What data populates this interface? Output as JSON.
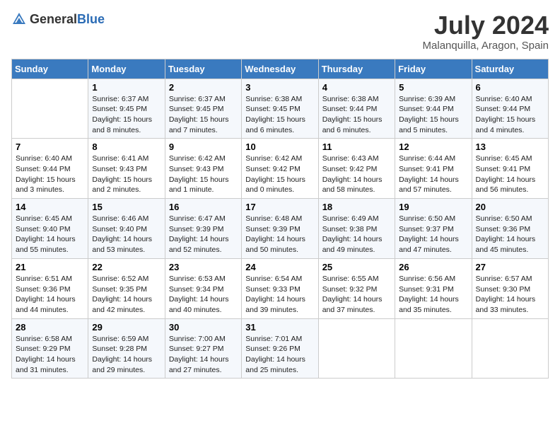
{
  "header": {
    "logo_general": "General",
    "logo_blue": "Blue",
    "month": "July 2024",
    "location": "Malanquilla, Aragon, Spain"
  },
  "days_of_week": [
    "Sunday",
    "Monday",
    "Tuesday",
    "Wednesday",
    "Thursday",
    "Friday",
    "Saturday"
  ],
  "weeks": [
    [
      {
        "day": "",
        "info": ""
      },
      {
        "day": "1",
        "info": "Sunrise: 6:37 AM\nSunset: 9:45 PM\nDaylight: 15 hours\nand 8 minutes."
      },
      {
        "day": "2",
        "info": "Sunrise: 6:37 AM\nSunset: 9:45 PM\nDaylight: 15 hours\nand 7 minutes."
      },
      {
        "day": "3",
        "info": "Sunrise: 6:38 AM\nSunset: 9:45 PM\nDaylight: 15 hours\nand 6 minutes."
      },
      {
        "day": "4",
        "info": "Sunrise: 6:38 AM\nSunset: 9:44 PM\nDaylight: 15 hours\nand 6 minutes."
      },
      {
        "day": "5",
        "info": "Sunrise: 6:39 AM\nSunset: 9:44 PM\nDaylight: 15 hours\nand 5 minutes."
      },
      {
        "day": "6",
        "info": "Sunrise: 6:40 AM\nSunset: 9:44 PM\nDaylight: 15 hours\nand 4 minutes."
      }
    ],
    [
      {
        "day": "7",
        "info": "Sunrise: 6:40 AM\nSunset: 9:44 PM\nDaylight: 15 hours\nand 3 minutes."
      },
      {
        "day": "8",
        "info": "Sunrise: 6:41 AM\nSunset: 9:43 PM\nDaylight: 15 hours\nand 2 minutes."
      },
      {
        "day": "9",
        "info": "Sunrise: 6:42 AM\nSunset: 9:43 PM\nDaylight: 15 hours\nand 1 minute."
      },
      {
        "day": "10",
        "info": "Sunrise: 6:42 AM\nSunset: 9:42 PM\nDaylight: 15 hours\nand 0 minutes."
      },
      {
        "day": "11",
        "info": "Sunrise: 6:43 AM\nSunset: 9:42 PM\nDaylight: 14 hours\nand 58 minutes."
      },
      {
        "day": "12",
        "info": "Sunrise: 6:44 AM\nSunset: 9:41 PM\nDaylight: 14 hours\nand 57 minutes."
      },
      {
        "day": "13",
        "info": "Sunrise: 6:45 AM\nSunset: 9:41 PM\nDaylight: 14 hours\nand 56 minutes."
      }
    ],
    [
      {
        "day": "14",
        "info": "Sunrise: 6:45 AM\nSunset: 9:40 PM\nDaylight: 14 hours\nand 55 minutes."
      },
      {
        "day": "15",
        "info": "Sunrise: 6:46 AM\nSunset: 9:40 PM\nDaylight: 14 hours\nand 53 minutes."
      },
      {
        "day": "16",
        "info": "Sunrise: 6:47 AM\nSunset: 9:39 PM\nDaylight: 14 hours\nand 52 minutes."
      },
      {
        "day": "17",
        "info": "Sunrise: 6:48 AM\nSunset: 9:39 PM\nDaylight: 14 hours\nand 50 minutes."
      },
      {
        "day": "18",
        "info": "Sunrise: 6:49 AM\nSunset: 9:38 PM\nDaylight: 14 hours\nand 49 minutes."
      },
      {
        "day": "19",
        "info": "Sunrise: 6:50 AM\nSunset: 9:37 PM\nDaylight: 14 hours\nand 47 minutes."
      },
      {
        "day": "20",
        "info": "Sunrise: 6:50 AM\nSunset: 9:36 PM\nDaylight: 14 hours\nand 45 minutes."
      }
    ],
    [
      {
        "day": "21",
        "info": "Sunrise: 6:51 AM\nSunset: 9:36 PM\nDaylight: 14 hours\nand 44 minutes."
      },
      {
        "day": "22",
        "info": "Sunrise: 6:52 AM\nSunset: 9:35 PM\nDaylight: 14 hours\nand 42 minutes."
      },
      {
        "day": "23",
        "info": "Sunrise: 6:53 AM\nSunset: 9:34 PM\nDaylight: 14 hours\nand 40 minutes."
      },
      {
        "day": "24",
        "info": "Sunrise: 6:54 AM\nSunset: 9:33 PM\nDaylight: 14 hours\nand 39 minutes."
      },
      {
        "day": "25",
        "info": "Sunrise: 6:55 AM\nSunset: 9:32 PM\nDaylight: 14 hours\nand 37 minutes."
      },
      {
        "day": "26",
        "info": "Sunrise: 6:56 AM\nSunset: 9:31 PM\nDaylight: 14 hours\nand 35 minutes."
      },
      {
        "day": "27",
        "info": "Sunrise: 6:57 AM\nSunset: 9:30 PM\nDaylight: 14 hours\nand 33 minutes."
      }
    ],
    [
      {
        "day": "28",
        "info": "Sunrise: 6:58 AM\nSunset: 9:29 PM\nDaylight: 14 hours\nand 31 minutes."
      },
      {
        "day": "29",
        "info": "Sunrise: 6:59 AM\nSunset: 9:28 PM\nDaylight: 14 hours\nand 29 minutes."
      },
      {
        "day": "30",
        "info": "Sunrise: 7:00 AM\nSunset: 9:27 PM\nDaylight: 14 hours\nand 27 minutes."
      },
      {
        "day": "31",
        "info": "Sunrise: 7:01 AM\nSunset: 9:26 PM\nDaylight: 14 hours\nand 25 minutes."
      },
      {
        "day": "",
        "info": ""
      },
      {
        "day": "",
        "info": ""
      },
      {
        "day": "",
        "info": ""
      }
    ]
  ]
}
